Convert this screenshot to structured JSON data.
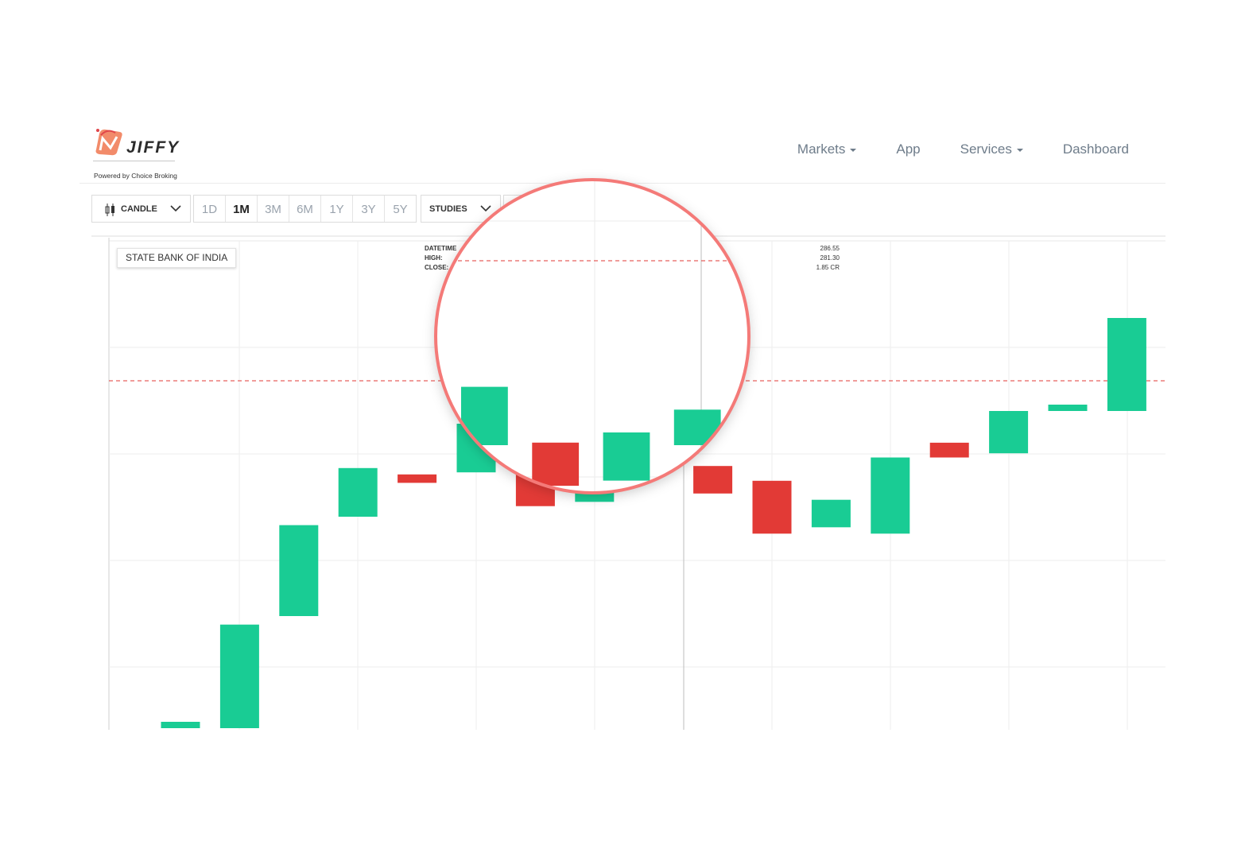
{
  "header": {
    "logo": {
      "word": "JIFFY",
      "tagline": "Powered by Choice Broking"
    },
    "nav": [
      {
        "label": "Markets",
        "dropdown": true
      },
      {
        "label": "App",
        "dropdown": false
      },
      {
        "label": "Services",
        "dropdown": true
      },
      {
        "label": "Dashboard",
        "dropdown": false
      }
    ]
  },
  "toolbar": {
    "chart_type": "CANDLE",
    "periods": [
      "1D",
      "1M",
      "3M",
      "6M",
      "1Y",
      "3Y",
      "5Y"
    ],
    "active_period": "1M",
    "studies_label": "STUDIES"
  },
  "chart": {
    "symbol": "STATE BANK OF INDIA",
    "info": {
      "labels": [
        "DATETIME",
        "HIGH:",
        "CLOSE:"
      ],
      "values": [
        "286.55",
        "281.30",
        "1.85 CR"
      ]
    }
  },
  "colors": {
    "up": "#19cc94",
    "down": "#e23a36",
    "magnifier_ring": "#f47a78",
    "nav_text": "#6e7c8a"
  },
  "chart_data": {
    "type": "candlestick",
    "series": [
      {
        "open": 100.0,
        "close": 100.3
      },
      {
        "open": 100.0,
        "close": 104.9
      },
      {
        "open": 105.3,
        "close": 109.6
      },
      {
        "open": 110.0,
        "close": 112.3
      },
      {
        "open": 112.0,
        "close": 111.6
      },
      {
        "open": 112.1,
        "close": 114.4
      },
      {
        "open": 112.2,
        "close": 110.5
      },
      {
        "open": 110.7,
        "close": 112.6
      },
      {
        "open": 112.1,
        "close": 113.5
      },
      {
        "open": 112.4,
        "close": 111.1
      },
      {
        "open": 111.7,
        "close": 109.2
      },
      {
        "open": 109.5,
        "close": 110.8
      },
      {
        "open": 109.2,
        "close": 112.8
      },
      {
        "open": 113.5,
        "close": 112.8
      },
      {
        "open": 113.0,
        "close": 115.0
      },
      {
        "open": 115.0,
        "close": 115.3
      },
      {
        "open": 115.0,
        "close": 119.4
      }
    ]
  }
}
